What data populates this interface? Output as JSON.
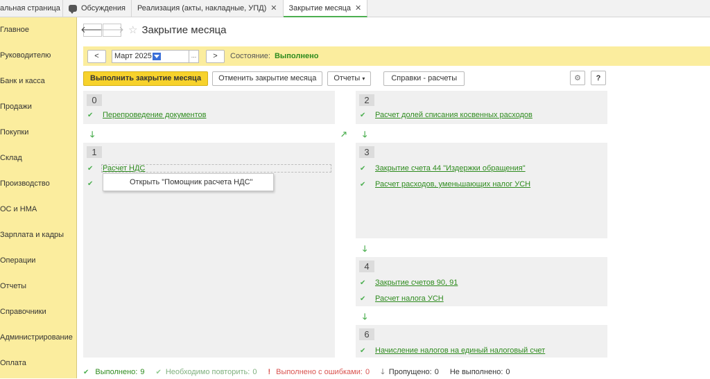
{
  "tabs": [
    {
      "label": "альная страница",
      "closable": false
    },
    {
      "label": "Обсуждения",
      "closable": false
    },
    {
      "label": "Реализация (акты, накладные, УПД)",
      "closable": true
    },
    {
      "label": "Закрытие месяца",
      "closable": true
    }
  ],
  "sidebar": {
    "items": [
      "Главное",
      "Руководителю",
      "Банк и касса",
      "Продажи",
      "Покупки",
      "Склад",
      "Производство",
      "ОС и НМА",
      "Зарплата и кадры",
      "Операции",
      "Отчеты",
      "Справочники",
      "Администрирование",
      "Оплата"
    ]
  },
  "header": {
    "back_glyph": "🡐",
    "forward_glyph": "🡒",
    "star_glyph": "☆",
    "title": "Закрытие месяца"
  },
  "period": {
    "prev": "<",
    "value": "Март 2025",
    "dots": "...",
    "next": ">",
    "state_label": "Состояние:",
    "state_value": "Выполнено"
  },
  "toolbar": {
    "run": "Выполнить закрытие месяца",
    "cancel": "Отменить закрытие месяца",
    "reports": "Отчеты",
    "reports_arrow": "▾",
    "refs": "Справки - расчеты",
    "gear": "⚙",
    "help": "?"
  },
  "stages": {
    "s0": {
      "num": "0",
      "steps": [
        "Перепроведение документов"
      ]
    },
    "s1": {
      "num": "1",
      "steps": [
        "Расчет НДС"
      ]
    },
    "s2": {
      "num": "2",
      "steps": [
        "Расчет долей списания косвенных расходов"
      ]
    },
    "s3": {
      "num": "3",
      "steps": [
        "Закрытие счета 44 \"Издержки обращения\"",
        "Расчет расходов, уменьшающих налог УСН"
      ]
    },
    "s4": {
      "num": "4",
      "steps": [
        "Закрытие счетов 90, 91",
        "Расчет налога УСН"
      ]
    },
    "s6": {
      "num": "6",
      "steps": [
        "Начисление налогов на единый налоговый счет"
      ]
    }
  },
  "context_menu": {
    "item": "Открыть \"Помощник расчета НДС\""
  },
  "glyphs": {
    "check": "✔",
    "down": "🡓",
    "diag": "🡕",
    "excl": "!",
    "skip": "🡓"
  },
  "status": {
    "done_label": "Выполнено:",
    "done_count": "9",
    "repeat_label": "Необходимо повторить:",
    "repeat_count": "0",
    "errors_label": "Выполнено с ошибками:",
    "errors_count": "0",
    "skipped_label": "Пропущено:",
    "skipped_count": "0",
    "notdone_label": "Не выполнено:",
    "notdone_count": "0"
  },
  "colors": {
    "accent_green": "#2e8b1e",
    "sidebar_yellow": "#fbed9e",
    "primary_button": "#f7d22c",
    "error_red": "#d9534f"
  }
}
